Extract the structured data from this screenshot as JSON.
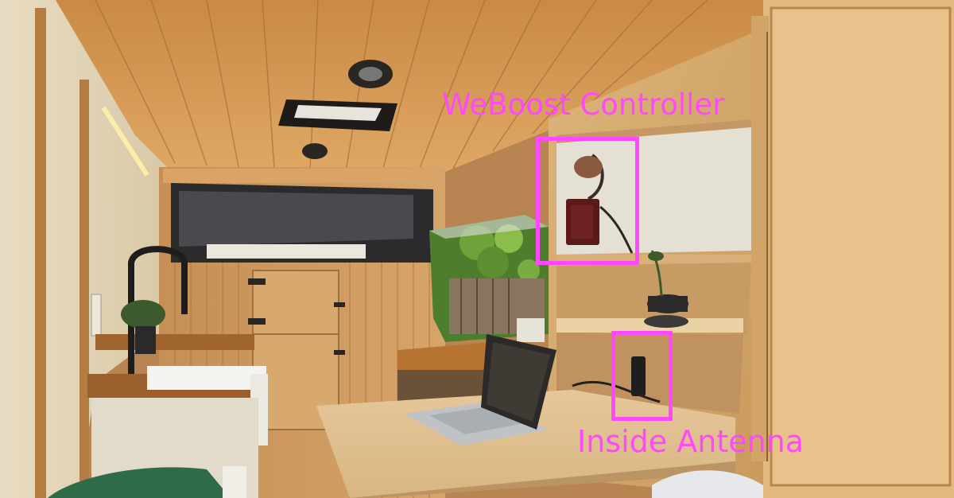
{
  "annotations": {
    "controller_label": "WeBoost Controller",
    "antenna_label": "Inside Antenna"
  },
  "colors": {
    "annotation": "#ff48ff"
  }
}
